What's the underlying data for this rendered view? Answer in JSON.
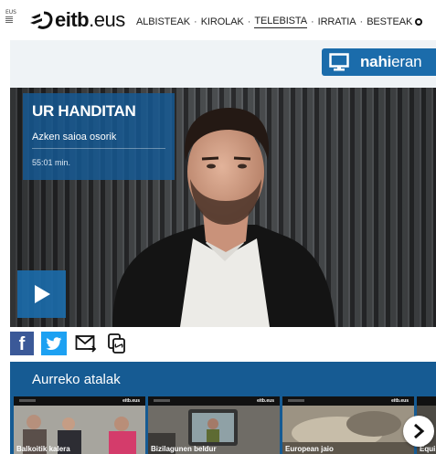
{
  "header": {
    "language": {
      "active": "EUS",
      "alternate": "ES"
    },
    "logo": {
      "brand": "eitb",
      "suffix": ".eus"
    },
    "nav": [
      {
        "label": "ALBISTEAK",
        "active": false
      },
      {
        "label": "KIROLAK",
        "active": false
      },
      {
        "label": "TELEBISTA",
        "active": true
      },
      {
        "label": "IRRATIA",
        "active": false
      },
      {
        "label": "BESTEAK",
        "active": false
      }
    ],
    "nav_separator": "·"
  },
  "nahieran": {
    "bold": "nahi",
    "light": "eran",
    "icon": "tv-monitor-icon"
  },
  "hero": {
    "program_title": "UR HANDITAN",
    "subtitle": "Azken saioa osorik",
    "duration": "55:01 min.",
    "play_icon": "play-icon"
  },
  "share": {
    "facebook_glyph": "f",
    "icons": [
      "facebook-icon",
      "twitter-icon",
      "email-icon",
      "copy-link-icon"
    ]
  },
  "episodes": {
    "heading": "Aurreko atalak",
    "thumb_logo": "eitb.eus",
    "items": [
      {
        "caption": "Balkoitik kalera"
      },
      {
        "caption": "Bizilagunen beldur"
      },
      {
        "caption": "European jaio"
      },
      {
        "caption": "Equi"
      }
    ],
    "next_icon": "chevron-right-icon"
  },
  "colors": {
    "brand_blue": "#1b6cab",
    "panel_blue": "#165b93",
    "facebook": "#3b5998",
    "twitter": "#1da1f2"
  }
}
